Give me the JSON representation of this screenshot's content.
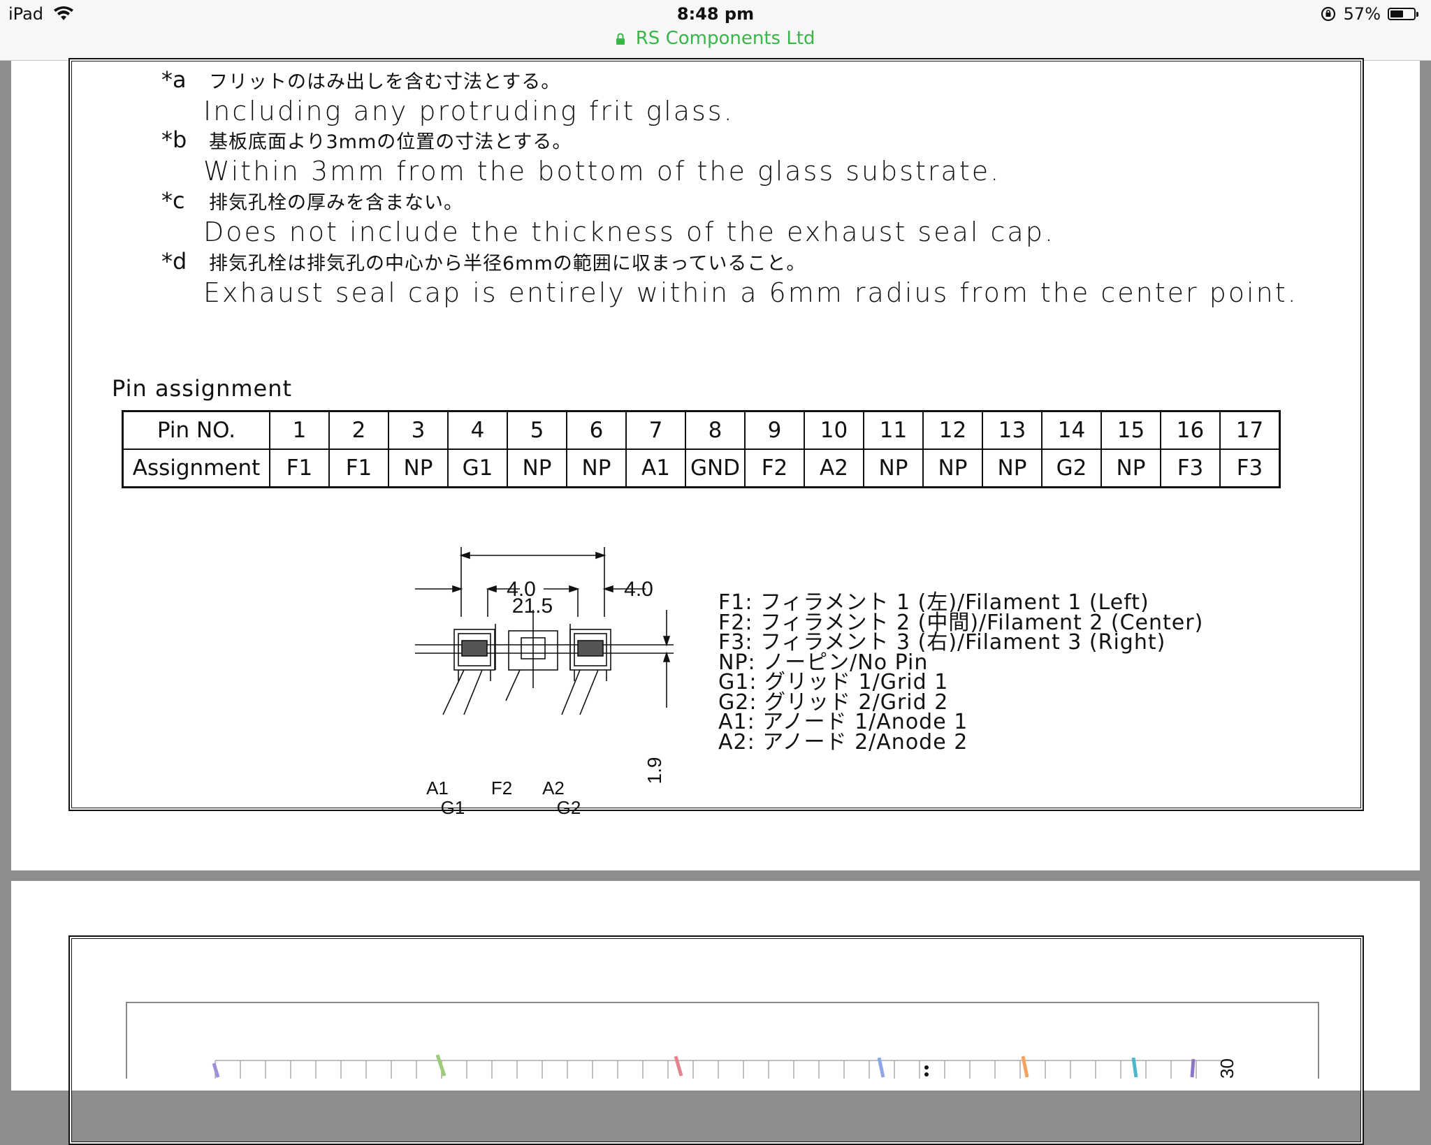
{
  "status_bar": {
    "device": "iPad",
    "time": "8:48 pm",
    "site": "RS Components Ltd",
    "battery_text": "57%",
    "battery_level": 0.57
  },
  "notes": [
    {
      "mark": "*a",
      "jp": "フリットのはみ出しを含む寸法とする。",
      "en": "Including any protruding frit glass."
    },
    {
      "mark": "*b",
      "jp": "基板底面より3mmの位置の寸法とする。",
      "en": "Within 3mm from the bottom of the glass substrate."
    },
    {
      "mark": "*c",
      "jp": "排気孔栓の厚みを含まない。",
      "en": "Does not include the thickness of the exhaust seal cap."
    },
    {
      "mark": "*d",
      "jp": "排気孔栓は排気孔の中心から半径6mmの範囲に収まっていること。",
      "en": "Exhaust seal cap is entirely within a 6mm radius from the center point."
    }
  ],
  "pin_table": {
    "title": "Pin assignment",
    "row1_header": "Pin NO.",
    "row2_header": "Assignment",
    "pins": [
      "1",
      "2",
      "3",
      "4",
      "5",
      "6",
      "7",
      "8",
      "9",
      "10",
      "11",
      "12",
      "13",
      "14",
      "15",
      "16",
      "17"
    ],
    "assignments": [
      "F1",
      "F1",
      "NP",
      "G1",
      "NP",
      "NP",
      "A1",
      "GND",
      "F2",
      "A2",
      "NP",
      "NP",
      "NP",
      "G2",
      "NP",
      "F3",
      "F3"
    ]
  },
  "diagram": {
    "dim_total": "21.5",
    "dim_a": "4.0",
    "dim_b": "4.0",
    "dim_height": "1.9",
    "label_a1": "A1",
    "label_g1": "G1",
    "label_f2": "F2",
    "label_a2": "A2",
    "label_g2": "G2"
  },
  "legend": [
    "F1: フィラメント 1 (左)/Filament 1 (Left)",
    "F2: フィラメント 2 (中間)/Filament 2 (Center)",
    "F3: フィラメント 3 (右)/Filament 3 (Right)",
    "NP: ノーピン/No Pin",
    "G1: グリッド 1/Grid 1",
    "G2: グリッド 2/Grid 2",
    "A1: アノード 1/Anode 1",
    "A2: アノード 2/Anode 2"
  ],
  "next_page_chart": {
    "y_tick_label": "30"
  }
}
